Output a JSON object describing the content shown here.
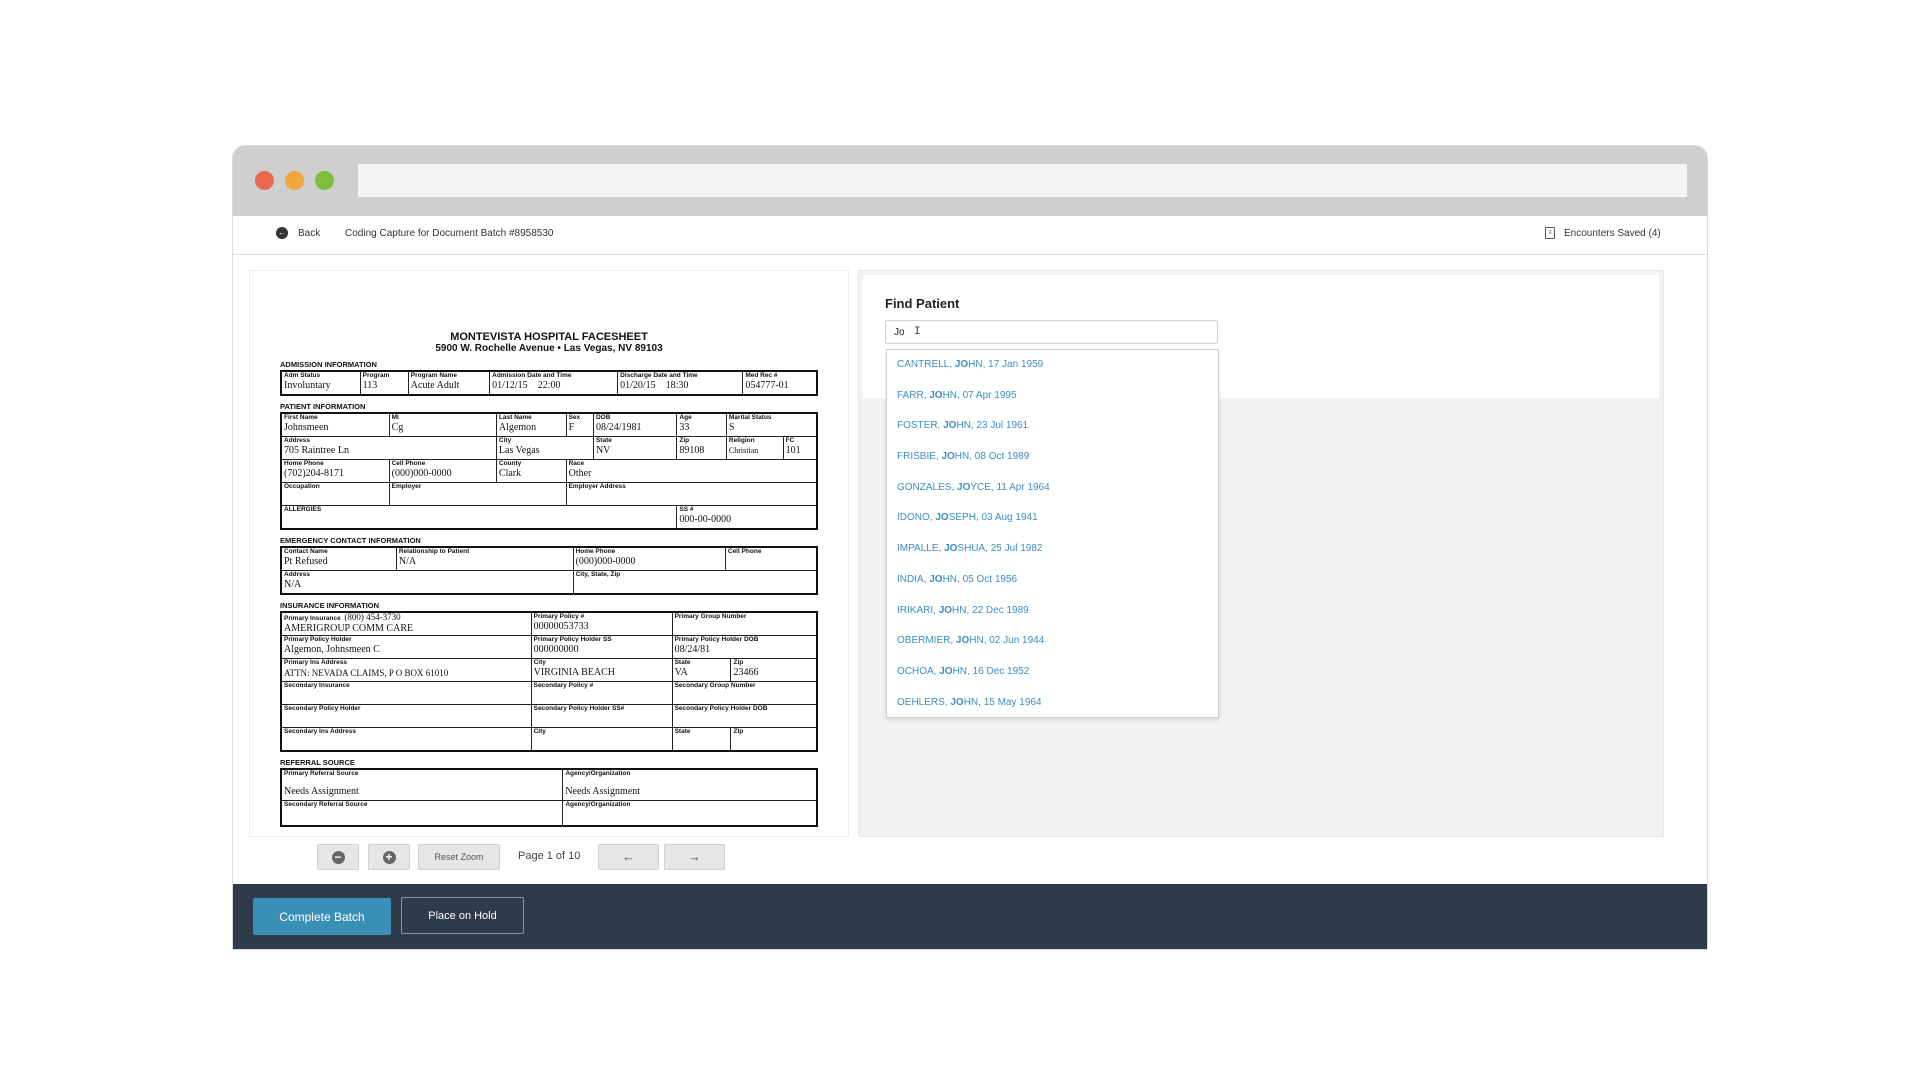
{
  "header": {
    "back_label": "Back",
    "breadcrumb": "Coding Capture for Document Batch #8958530",
    "encounters_saved": "Encounters Saved (4)"
  },
  "document": {
    "title": "MONTEVISTA HOSPITAL FACESHEET",
    "address": "5900 W. Rochelle Avenue • Las Vegas, NV 89103",
    "sections": {
      "admission": "ADMISSION INFORMATION",
      "patient": "PATIENT INFORMATION",
      "emergency": "EMERGENCY CONTACT INFORMATION",
      "insurance": "INSURANCE INFORMATION",
      "referral": "REFERRAL SOURCE"
    },
    "admission": {
      "adm_status": {
        "label": "Adm Status",
        "value": "Involuntary"
      },
      "program": {
        "label": "Program",
        "value": "113"
      },
      "program_name": {
        "label": "Program Name",
        "value": "Acute Adult"
      },
      "admission_date": {
        "label": "Admission Date and Time",
        "value": "01/12/15"
      },
      "admission_time": {
        "value": "22:00"
      },
      "discharge_date": {
        "label": "Discharge Date and Time",
        "value": "01/20/15"
      },
      "discharge_time": {
        "value": "18:30"
      },
      "med_rec": {
        "label": "Med Rec #",
        "value": "054777-01"
      }
    },
    "patient": {
      "first_name": {
        "label": "First Name",
        "value": "Johnsmeen"
      },
      "mi": {
        "label": "MI",
        "value": "Cg"
      },
      "last_name": {
        "label": "Last Name",
        "value": "Algemon"
      },
      "sex": {
        "label": "Sex",
        "value": "F"
      },
      "dob": {
        "label": "DOB",
        "value": "08/24/1981"
      },
      "age": {
        "label": "Age",
        "value": "33"
      },
      "marital": {
        "label": "Marital Status",
        "value": "S"
      },
      "address": {
        "label": "Address",
        "value": "705 Raintree Ln"
      },
      "city": {
        "label": "City",
        "value": "Las Vegas"
      },
      "state": {
        "label": "State",
        "value": "NV"
      },
      "zip": {
        "label": "Zip",
        "value": "89108"
      },
      "religion": {
        "label": "Religion",
        "value": "Christian"
      },
      "fc": {
        "label": "FC",
        "value": "101"
      },
      "home_phone": {
        "label": "Home Phone",
        "value": "(702)204-8171"
      },
      "cell_phone": {
        "label": "Cell Phone",
        "value": "(000)000-0000"
      },
      "county": {
        "label": "County",
        "value": "Clark"
      },
      "race": {
        "label": "Race",
        "value": "Other"
      },
      "occupation": {
        "label": "Occupation",
        "value": ""
      },
      "employer": {
        "label": "Employer",
        "value": ""
      },
      "employer_address": {
        "label": "Employer Address",
        "value": ""
      },
      "allergies": {
        "label": "ALLERGIES",
        "value": ""
      },
      "ss": {
        "label": "SS #",
        "value": "000-00-0000"
      }
    },
    "emergency": {
      "contact_name": {
        "label": "Contact Name",
        "value": "Pt Refused"
      },
      "relationship": {
        "label": "Relationship to Patient",
        "value": "N/A"
      },
      "home_phone": {
        "label": "Home Phone",
        "value": "(000)000-0000"
      },
      "cell_phone": {
        "label": "Cell Phone",
        "value": ""
      },
      "address": {
        "label": "Address",
        "value": "N/A"
      },
      "city_state_zip": {
        "label": "City, State, Zip",
        "value": ""
      }
    },
    "insurance": {
      "primary_ins": {
        "label": "Primary Insurance",
        "phone": "(800) 454-3730",
        "value": "AMERIGROUP COMM CARE"
      },
      "primary_policy": {
        "label": "Primary Policy #",
        "value": "00000053733"
      },
      "primary_group": {
        "label": "Primary Group Number",
        "value": ""
      },
      "policy_holder": {
        "label": "Primary Policy Holder",
        "value": "Algemon, Johnsmeen C"
      },
      "holder_ss": {
        "label": "Primary Policy Holder SS",
        "value": "000000000"
      },
      "holder_dob": {
        "label": "Primary Policy Holder DOB",
        "value": "08/24/81"
      },
      "ins_address": {
        "label": "Primary Ins Address",
        "value": "ATTN: NEVADA CLAIMS, P O BOX 61010"
      },
      "ins_city": {
        "label": "City",
        "value": "VIRGINIA BEACH"
      },
      "ins_state": {
        "label": "State",
        "value": "VA"
      },
      "ins_zip": {
        "label": "Zip",
        "value": "23466"
      },
      "secondary_ins": {
        "label": "Secondary Insurance"
      },
      "secondary_policy": {
        "label": "Secondary Policy #"
      },
      "secondary_group": {
        "label": "Secondary Group Number"
      },
      "secondary_holder": {
        "label": "Secondary Policy Holder"
      },
      "secondary_holder_ss": {
        "label": "Secondary Policy Holder SS#"
      },
      "secondary_holder_dob": {
        "label": "Secondary Policy Holder DOB"
      },
      "secondary_address": {
        "label": "Secondary Ins Address"
      },
      "secondary_city": {
        "label": "City"
      },
      "secondary_state": {
        "label": "State"
      },
      "secondary_zip": {
        "label": "Zip"
      }
    },
    "referral": {
      "primary_source": {
        "label": "Primary Referral Source",
        "value": "Needs Assignment"
      },
      "agency1": {
        "label": "Agency/Organization",
        "value": "Needs Assignment"
      },
      "secondary_source": {
        "label": "Secondary Referral Source",
        "value": ""
      },
      "agency2": {
        "label": "Agency/Organization",
        "value": ""
      }
    }
  },
  "viewer": {
    "zoom_out_icon": "minus-circle-icon",
    "zoom_in_icon": "plus-circle-icon",
    "reset_zoom": "Reset Zoom",
    "page_info": "Page 1 of 10",
    "prev_icon": "←",
    "next_icon": "→"
  },
  "find_patient": {
    "title": "Find Patient",
    "query": "Jo",
    "results": [
      {
        "pre": "CANTRELL, ",
        "match": "JO",
        "post": "HN, 17 Jan 1959"
      },
      {
        "pre": "FARR, ",
        "match": "JO",
        "post": "HN, 07 Apr 1995"
      },
      {
        "pre": "FOSTER, ",
        "match": "JO",
        "post": "HN, 23 Jul 1961"
      },
      {
        "pre": "FRISBIE, ",
        "match": "JO",
        "post": "HN, 08 Oct 1989"
      },
      {
        "pre": "GONZALES, ",
        "match": "JO",
        "post": "YCE, 11 Apr 1964"
      },
      {
        "pre": "IDONO, ",
        "match": "JO",
        "post": "SEPH, 03 Aug 1941"
      },
      {
        "pre": "IMPALLE, ",
        "match": "JO",
        "post": "SHUA, 25 Jul 1982"
      },
      {
        "pre": "INDIA, ",
        "match": "JO",
        "post": "HN, 05 Oct 1956"
      },
      {
        "pre": "IRIKARI, ",
        "match": "JO",
        "post": "HN, 22 Dec 1989"
      },
      {
        "pre": "OBERMIER, ",
        "match": "JO",
        "post": "HN, 02 Jun 1944"
      },
      {
        "pre": "OCHOA, ",
        "match": "JO",
        "post": "HN, 16 Dec 1952"
      },
      {
        "pre": "OEHLERS, ",
        "match": "JO",
        "post": "HN, 15 May 1964"
      }
    ]
  },
  "footer": {
    "complete_batch": "Complete Batch",
    "place_on_hold": "Place on Hold"
  },
  "colors": {
    "footer_bg": "#2e3b4a",
    "primary_button": "#3a8fb7",
    "link_blue": "#3c8dc4",
    "close_dot": "#e9664f",
    "minimize_dot": "#efa63a",
    "maximize_dot": "#7ebe3c"
  }
}
